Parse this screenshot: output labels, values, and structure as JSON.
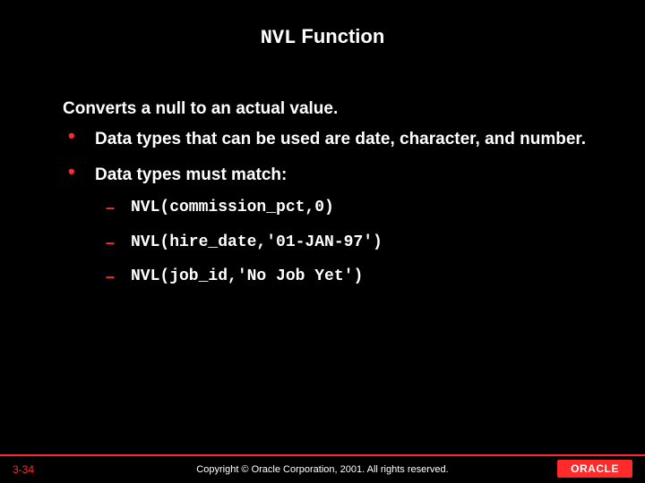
{
  "title": {
    "code": "NVL",
    "rest": " Function"
  },
  "intro": "Converts a null to an actual value.",
  "bullets": [
    {
      "text": "Data types that can be used are date, character, and number."
    },
    {
      "text": "Data types must match:",
      "sub": [
        "NVL(commission_pct,0)",
        "NVL(hire_date,'01-JAN-97')",
        "NVL(job_id,'No Job Yet')"
      ]
    }
  ],
  "footer": {
    "page": "3-34",
    "copyright": "Copyright © Oracle Corporation, 2001. All rights reserved.",
    "logo": "ORACLE"
  }
}
